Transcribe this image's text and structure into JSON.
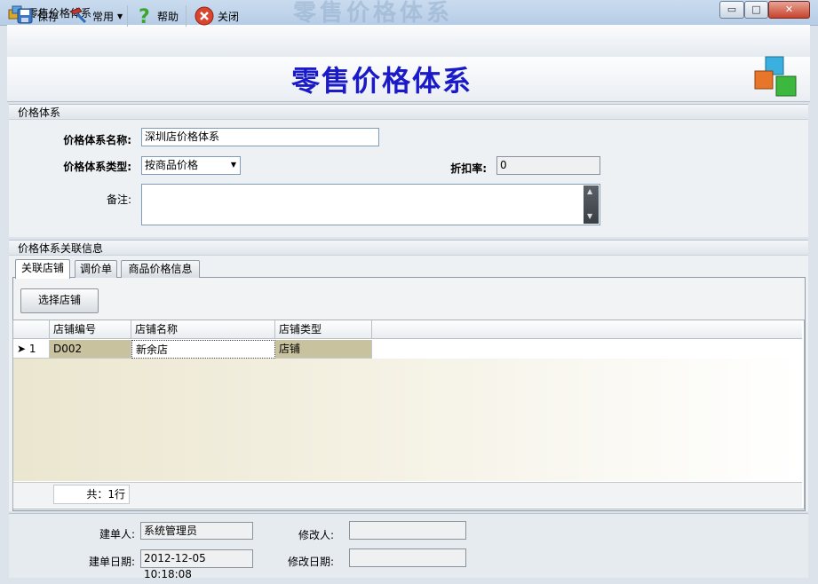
{
  "window": {
    "title": "零售价格体系",
    "ghost_title": "零售价格体系",
    "minimize": "▭",
    "maximize": "□",
    "close": "✕"
  },
  "toolbar": {
    "save_label": "保存",
    "common_label": "常用",
    "help_label": "帮助",
    "close_label": "关闭"
  },
  "header": {
    "title": "零售价格体系"
  },
  "price_system": {
    "section_title": "价格体系",
    "name_label": "价格体系名称:",
    "name_value": "深圳店价格体系",
    "type_label": "价格体系类型:",
    "type_value": "按商品价格",
    "discount_label": "折扣率:",
    "discount_value": "0",
    "remark_label": "备注:",
    "remark_value": ""
  },
  "related": {
    "section_title": "价格体系关联信息",
    "tabs": [
      {
        "label": "关联店铺"
      },
      {
        "label": "调价单"
      },
      {
        "label": "商品价格信息"
      }
    ],
    "select_store_button": "选择店铺",
    "columns": [
      "店铺编号",
      "店铺名称",
      "店铺类型"
    ],
    "rows": [
      {
        "indicator": "➤",
        "index": "1",
        "code": "D002",
        "name": "新余店",
        "type": "店铺"
      }
    ],
    "footer_total": "共：1行"
  },
  "audit": {
    "creator_label": "建单人:",
    "creator_value": "系统管理员",
    "modifier_label": "修改人:",
    "modifier_value": "",
    "created_label": "建单日期:",
    "created_value": "2012-12-05 10:18:08",
    "modified_label": "修改日期:",
    "modified_value": ""
  }
}
